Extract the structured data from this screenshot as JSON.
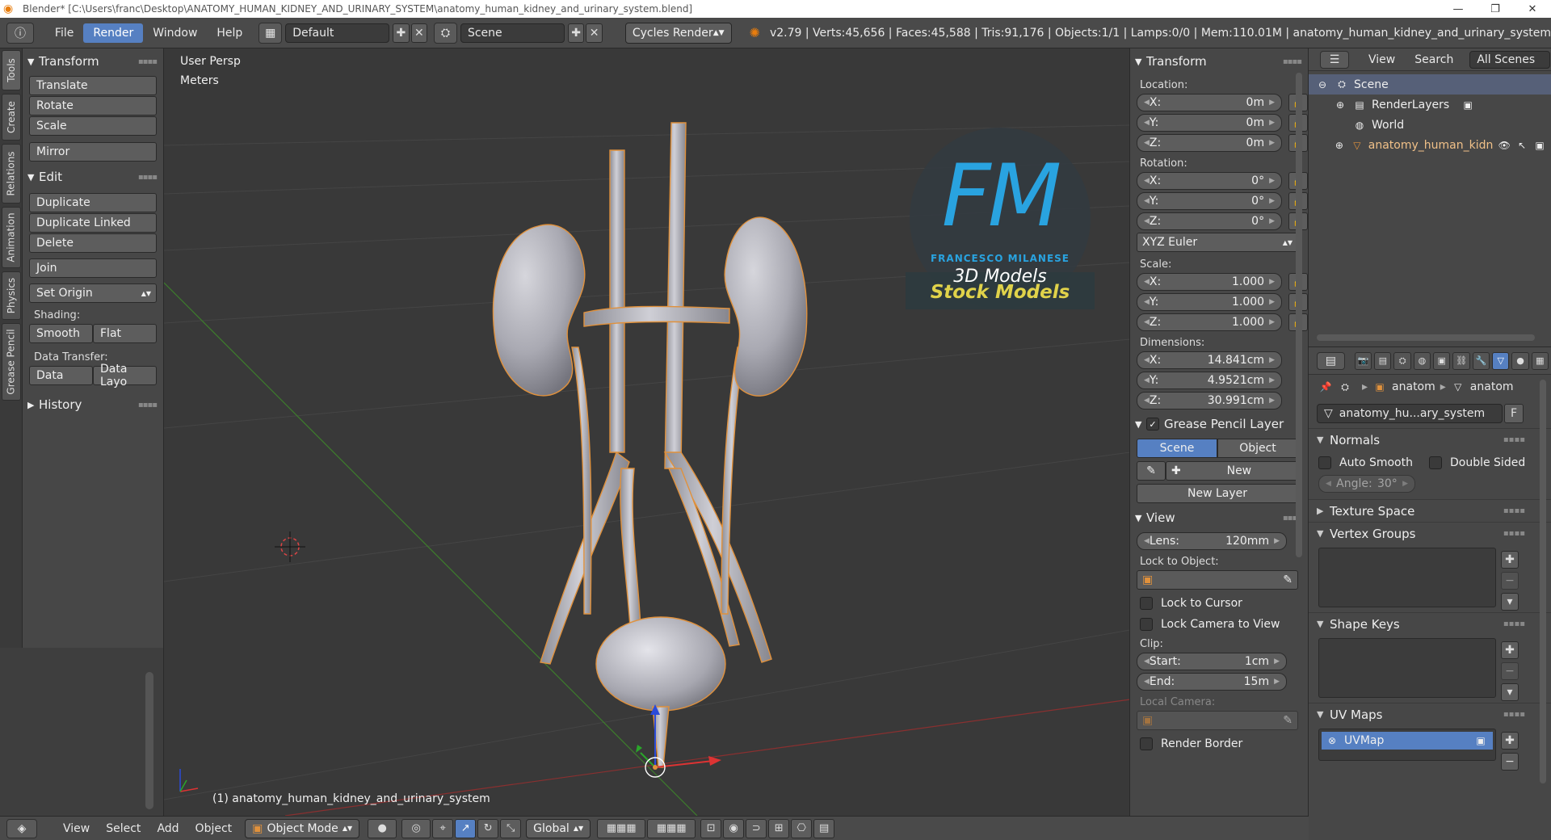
{
  "window": {
    "title": "Blender* [C:\\Users\\franc\\Desktop\\ANATOMY_HUMAN_KIDNEY_AND_URINARY_SYSTEM\\anatomy_human_kidney_and_urinary_system.blend]",
    "minimize": "—",
    "maximize": "❐",
    "close": "✕"
  },
  "topbar": {
    "menus": [
      "File",
      "Render",
      "Window",
      "Help"
    ],
    "active_menu": "Render",
    "layout": "Default",
    "scene": "Scene",
    "engine": "Cycles Render",
    "stats": "v2.79 | Verts:45,656 | Faces:45,588 | Tris:91,176 | Objects:1/1 | Lamps:0/0 | Mem:110.01M | anatomy_human_kidney_and_urinary_system"
  },
  "lefttabs": [
    "Tools",
    "Create",
    "Relations",
    "Animation",
    "Physics",
    "Grease Pencil"
  ],
  "toolshelf": {
    "transform_title": "Transform",
    "translate": "Translate",
    "rotate": "Rotate",
    "scale": "Scale",
    "mirror": "Mirror",
    "edit_title": "Edit",
    "duplicate": "Duplicate",
    "duplicate_linked": "Duplicate Linked",
    "delete": "Delete",
    "join": "Join",
    "set_origin": "Set Origin",
    "shading_label": "Shading:",
    "smooth": "Smooth",
    "flat": "Flat",
    "data_transfer_label": "Data Transfer:",
    "data": "Data",
    "data_layout": "Data Layo",
    "history_title": "History"
  },
  "viewport": {
    "view_name": "User Persp",
    "units": "Meters",
    "object_label": "(1) anatomy_human_kidney_and_urinary_system",
    "logo_letters": "FM",
    "logo_name": "FRANCESCO MILANESE",
    "logo_sub": "3D Models",
    "stock": "Stock Models"
  },
  "vheader": {
    "menus": [
      "View",
      "Select",
      "Add",
      "Object"
    ],
    "mode": "Object Mode",
    "orientation": "Global"
  },
  "npanel": {
    "transform_title": "Transform",
    "location_label": "Location:",
    "location": [
      {
        "axis": "X:",
        "value": "0m"
      },
      {
        "axis": "Y:",
        "value": "0m"
      },
      {
        "axis": "Z:",
        "value": "0m"
      }
    ],
    "rotation_label": "Rotation:",
    "rotation": [
      {
        "axis": "X:",
        "value": "0°"
      },
      {
        "axis": "Y:",
        "value": "0°"
      },
      {
        "axis": "Z:",
        "value": "0°"
      }
    ],
    "rotation_mode": "XYZ Euler",
    "scale_label": "Scale:",
    "scale": [
      {
        "axis": "X:",
        "value": "1.000"
      },
      {
        "axis": "Y:",
        "value": "1.000"
      },
      {
        "axis": "Z:",
        "value": "1.000"
      }
    ],
    "dimensions_label": "Dimensions:",
    "dimensions": [
      {
        "axis": "X:",
        "value": "14.841cm"
      },
      {
        "axis": "Y:",
        "value": "4.9521cm"
      },
      {
        "axis": "Z:",
        "value": "30.991cm"
      }
    ],
    "grease_title": "Grease Pencil Layer",
    "grease_scene": "Scene",
    "grease_object": "Object",
    "grease_new": "New",
    "grease_new_layer": "New Layer",
    "view_title": "View",
    "lens_label": "Lens:",
    "lens_value": "120mm",
    "lock_object_label": "Lock to Object:",
    "lock_cursor": "Lock to Cursor",
    "lock_camera": "Lock Camera to View",
    "clip_label": "Clip:",
    "clip_start_label": "Start:",
    "clip_start": "1cm",
    "clip_end_label": "End:",
    "clip_end": "15m",
    "local_camera_label": "Local Camera:",
    "render_border": "Render Border"
  },
  "outliner": {
    "view": "View",
    "search": "Search",
    "filter": "All Scenes",
    "scene": "Scene",
    "renderlayers": "RenderLayers",
    "world": "World",
    "object": "anatomy_human_kidn"
  },
  "props": {
    "crumb1": "anatom",
    "crumb2": "anatom",
    "mesh_name": "anatomy_hu...ary_system",
    "fake_user": "F",
    "normals_title": "Normals",
    "auto_smooth": "Auto Smooth",
    "double_sided": "Double Sided",
    "angle_label": "Angle:",
    "angle_value": "30°",
    "texture_space": "Texture Space",
    "vertex_groups": "Vertex Groups",
    "shape_keys": "Shape Keys",
    "uv_maps": "UV Maps",
    "uvmap": "UVMap"
  },
  "colors": {
    "accent": "#5680c2",
    "logo_blue": "#29a3e0",
    "stock_yellow": "#e0d24a",
    "selection_orange": "#e0913c"
  }
}
